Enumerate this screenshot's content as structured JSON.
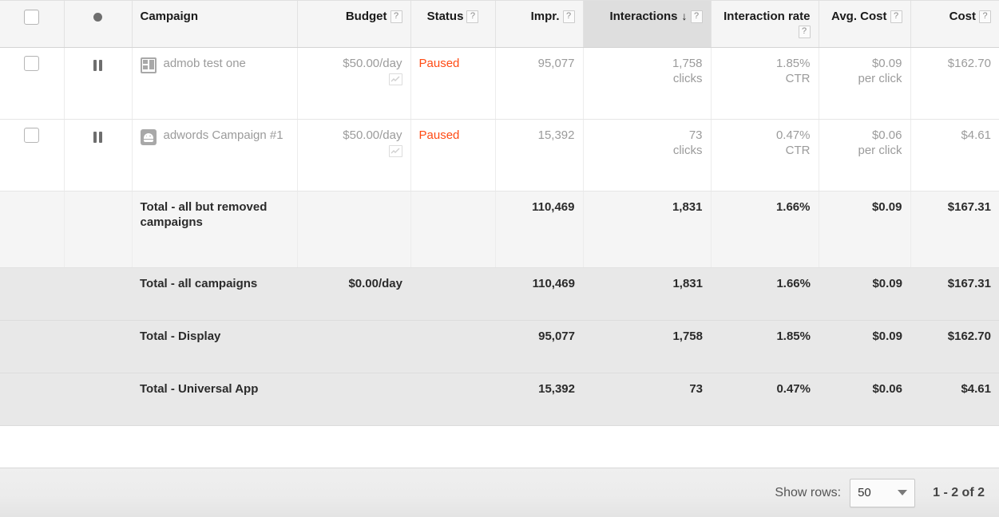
{
  "table": {
    "columns": [
      {
        "key": "select",
        "label": "",
        "help": false,
        "align": "center"
      },
      {
        "key": "state",
        "label": "",
        "help": false,
        "align": "center"
      },
      {
        "key": "campaign",
        "label": "Campaign",
        "help": false,
        "align": "left"
      },
      {
        "key": "budget",
        "label": "Budget",
        "help": true,
        "align": "right"
      },
      {
        "key": "status",
        "label": "Status",
        "help": true,
        "align": "left"
      },
      {
        "key": "impr",
        "label": "Impr.",
        "help": true,
        "align": "right"
      },
      {
        "key": "interactions",
        "label": "Interactions",
        "help": true,
        "align": "right",
        "sorted": true,
        "sort_dir": "↓"
      },
      {
        "key": "int_rate",
        "label": "Interaction rate",
        "help": true,
        "align": "right"
      },
      {
        "key": "avg_cost",
        "label": "Avg. Cost",
        "help": true,
        "align": "right"
      },
      {
        "key": "cost",
        "label": "Cost",
        "help": true,
        "align": "right"
      }
    ],
    "rows": [
      {
        "state_icon": "pause-icon",
        "campaign_icon": "display-campaign-icon",
        "campaign": "admob test one",
        "budget": "$50.00/day",
        "status": "Paused",
        "impr": "95,077",
        "interactions": "1,758",
        "interactions_unit": "clicks",
        "int_rate": "1.85%",
        "int_rate_unit": "CTR",
        "avg_cost": "$0.09",
        "avg_cost_unit": "per click",
        "cost": "$162.70"
      },
      {
        "state_icon": "pause-icon",
        "campaign_icon": "android-campaign-icon",
        "campaign": "adwords Campaign #1",
        "budget": "$50.00/day",
        "status": "Paused",
        "impr": "15,392",
        "interactions": "73",
        "interactions_unit": "clicks",
        "int_rate": "0.47%",
        "int_rate_unit": "CTR",
        "avg_cost": "$0.06",
        "avg_cost_unit": "per click",
        "cost": "$4.61"
      }
    ],
    "totals": [
      {
        "variant": "sub",
        "label": "Total - all but removed campaigns",
        "budget": "",
        "impr": "110,469",
        "interactions": "1,831",
        "int_rate": "1.66%",
        "avg_cost": "$0.09",
        "cost": "$167.31"
      },
      {
        "variant": "main",
        "label": "Total - all campaigns",
        "budget": "$0.00/day",
        "impr": "110,469",
        "interactions": "1,831",
        "int_rate": "1.66%",
        "avg_cost": "$0.09",
        "cost": "$167.31"
      },
      {
        "variant": "main",
        "label": "Total - Display",
        "budget": "",
        "impr": "95,077",
        "interactions": "1,758",
        "int_rate": "1.85%",
        "avg_cost": "$0.09",
        "cost": "$162.70"
      },
      {
        "variant": "main",
        "label": "Total - Universal App",
        "budget": "",
        "impr": "15,392",
        "interactions": "73",
        "int_rate": "0.47%",
        "avg_cost": "$0.06",
        "cost": "$4.61"
      }
    ]
  },
  "footer": {
    "show_rows_label": "Show rows:",
    "rows_per_page": "50",
    "page_range": "1 - 2 of 2"
  },
  "colors": {
    "paused": "#ff4b14",
    "header_bg": "#f5f5f5",
    "sorted_header_bg": "#dedede",
    "total_sub_bg": "#f5f5f5",
    "total_main_bg": "#e8e8e8"
  },
  "help_glyph": "?"
}
